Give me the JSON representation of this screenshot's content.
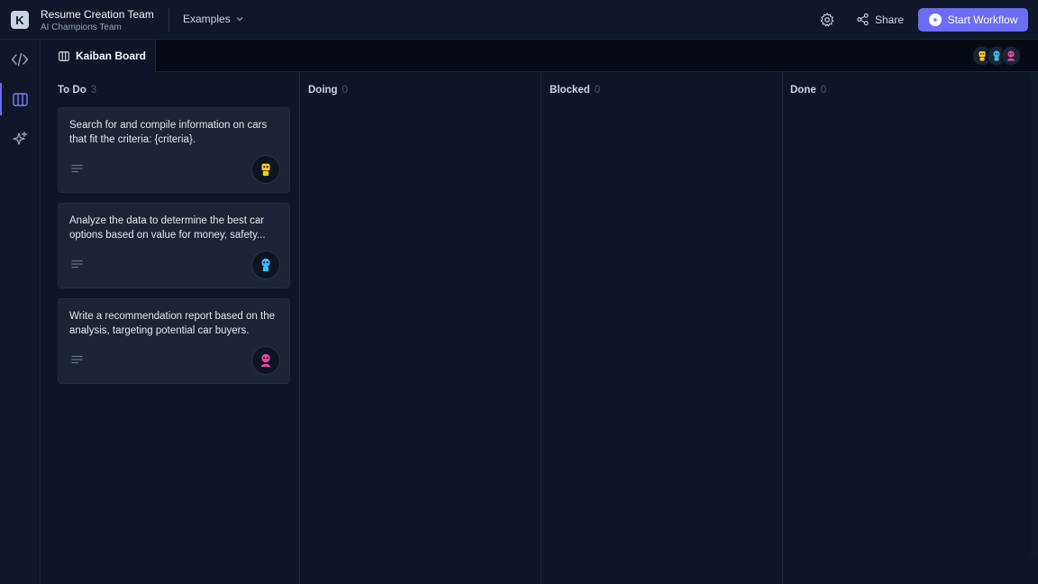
{
  "header": {
    "logo_letter": "K",
    "team_title": "Resume Creation Team",
    "team_subtitle": "AI Champions Team",
    "examples_label": "Examples",
    "share_label": "Share",
    "start_label": "Start Workflow"
  },
  "tabs": [
    {
      "label": "Kaiban Board",
      "active": true
    }
  ],
  "rail": {
    "items": [
      {
        "icon": "code-icon",
        "active": false
      },
      {
        "icon": "board-icon",
        "active": true
      },
      {
        "icon": "sparkles-icon",
        "active": false
      }
    ]
  },
  "board": {
    "columns": [
      {
        "title": "To Do",
        "count": "3",
        "cards": [
          {
            "text": "Search for and compile information on cars that fit the criteria: {criteria}.",
            "agent_color": "#facc15"
          },
          {
            "text": "Analyze the data to determine the best car options based on value for money, safety...",
            "agent_color": "#38bdf8"
          },
          {
            "text": "Write a recommendation report based on the analysis, targeting potential car buyers.",
            "agent_color": "#ec4899"
          }
        ]
      },
      {
        "title": "Doing",
        "count": "0",
        "cards": []
      },
      {
        "title": "Blocked",
        "count": "0",
        "cards": []
      },
      {
        "title": "Done",
        "count": "0",
        "cards": []
      }
    ]
  },
  "agents": [
    {
      "name": "agent-yellow",
      "color": "#facc15"
    },
    {
      "name": "agent-blue",
      "color": "#38bdf8"
    },
    {
      "name": "agent-pink",
      "color": "#ec4899"
    }
  ],
  "colors": {
    "accent": "#6c6cf6",
    "background": "#0f1526",
    "card": "#1b2335"
  }
}
